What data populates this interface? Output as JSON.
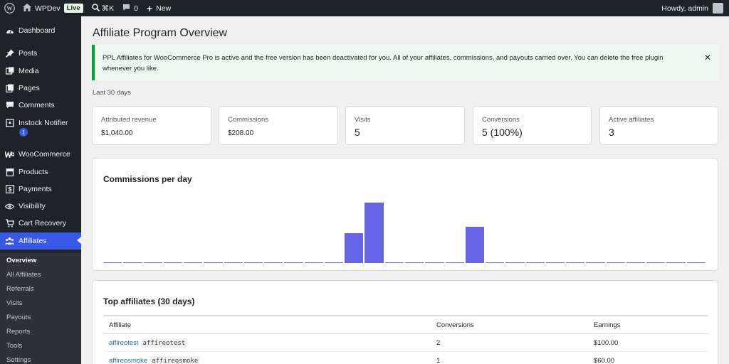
{
  "adminbar": {
    "site_name": "WPDev",
    "live_badge": "Live",
    "search_shortcut": "⌘K",
    "comments_count": "0",
    "new_label": "New",
    "greeting": "Howdy, admin"
  },
  "sidebar": {
    "items": [
      {
        "label": "Dashboard",
        "icon": "dashboard-icon"
      },
      {
        "label": "Posts",
        "icon": "pin-icon"
      },
      {
        "label": "Media",
        "icon": "media-icon"
      },
      {
        "label": "Pages",
        "icon": "pages-icon"
      },
      {
        "label": "Comments",
        "icon": "comment-icon"
      },
      {
        "label": "Instock Notifier",
        "icon": "bell-icon"
      },
      {
        "label": "WooCommerce",
        "icon": "woo-icon"
      },
      {
        "label": "Products",
        "icon": "box-icon"
      },
      {
        "label": "Payments",
        "icon": "payment-icon"
      },
      {
        "label": "Visibility",
        "icon": "eye-icon"
      },
      {
        "label": "Cart Recovery",
        "icon": "cart-icon"
      },
      {
        "label": "Affiliates",
        "icon": "people-icon"
      }
    ],
    "instock_badge": "1",
    "submenu": [
      "Overview",
      "All Affiliates",
      "Referrals",
      "Visits",
      "Payouts",
      "Reports",
      "Tools",
      "Settings"
    ]
  },
  "page": {
    "title": "Affiliate Program Overview",
    "notice": "PPL Affiliates for WooCommerce Pro is active and the free version has been deactivated for you. All of your affiliates, commissions, and payouts carried over. You can delete the free plugin whenever you like.",
    "notice_close": "✕",
    "period": "Last 30 days"
  },
  "stats": [
    {
      "label": "Attributed revenue",
      "value": "$1,040.00"
    },
    {
      "label": "Commissions",
      "value": "$208.00"
    },
    {
      "label": "Visits",
      "value": "5"
    },
    {
      "label": "Conversions",
      "value": "5 (100%)"
    },
    {
      "label": "Active affiliates",
      "value": "3"
    }
  ],
  "chart_panel": {
    "title": "Commissions per day"
  },
  "chart_data": {
    "type": "bar",
    "title": "Commissions per day",
    "xlabel": "",
    "ylabel": "",
    "categories_count": 30,
    "values": [
      0,
      0,
      0,
      0,
      0,
      0,
      0,
      0,
      0,
      0,
      0,
      0,
      40,
      80,
      0,
      0,
      0,
      0,
      48,
      0,
      0,
      0,
      0,
      0,
      0,
      0,
      0,
      0,
      0,
      0
    ],
    "ylim": [
      0,
      80
    ],
    "color": "#6764e6"
  },
  "top_affiliates": {
    "title": "Top affiliates (30 days)",
    "columns": [
      "Affiliate",
      "Conversions",
      "Earnings"
    ],
    "rows": [
      {
        "name": "affireotest",
        "code": "affireotest",
        "conversions": "2",
        "earnings": "$100.00"
      },
      {
        "name": "affireosmoke",
        "code": "affireosmoke",
        "conversions": "1",
        "earnings": "$60.00"
      }
    ]
  },
  "colors": {
    "accent": "#3858e9",
    "sidebar_bg": "#1d2327",
    "notice_border": "#00a32a",
    "bar": "#6764e6",
    "link": "#2271b1"
  }
}
